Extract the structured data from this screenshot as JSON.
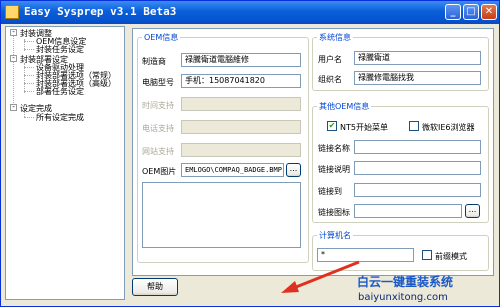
{
  "window": {
    "title": "Easy Sysprep v3.1 Beta3"
  },
  "tree": {
    "items": [
      {
        "label": "封装调整"
      },
      {
        "label": "OEM信息设定"
      },
      {
        "label": "封装任务设定"
      },
      {
        "label": "封装部署设定"
      },
      {
        "label": "设备驱动处理"
      },
      {
        "label": "封装部署选项（常规）"
      },
      {
        "label": "封装部署选项（高级）"
      },
      {
        "label": "部署任务设定"
      },
      {
        "label": "设定完成"
      },
      {
        "label": "所有设定完成"
      }
    ]
  },
  "oem": {
    "legend": "OEM信息",
    "manufacturer_label": "制造商",
    "manufacturer_value": "禄騰衛道電腦維修",
    "model_label": "电脑型号",
    "model_value": "手机：15087041820",
    "hours_label": "时间支持",
    "phone_label": "电话支持",
    "web_label": "网站支持",
    "image_label": "OEM图片",
    "image_value": "EMLOGO\\COMPAQ_BADGE.BMP",
    "browse_label": "..."
  },
  "system": {
    "legend": "系统信息",
    "user_label": "用户名",
    "user_value": "禄騰衛道",
    "org_label": "组织名",
    "org_value": "禄騰修電腦找我"
  },
  "other": {
    "legend": "其他OEM信息",
    "nt5_label": "NT5开始菜单",
    "nt5_checked": true,
    "ie6_label": "微软IE6浏览器",
    "ie6_checked": false,
    "link_name_label": "链接名称",
    "link_desc_label": "链接说明",
    "link_to_label": "链接到",
    "link_icon_label": "链接图标",
    "browse_label": "..."
  },
  "computer": {
    "legend": "计算机名",
    "value": "*",
    "prefix_label": "前缀模式",
    "prefix_checked": false
  },
  "footer": {
    "help_label": "帮助"
  },
  "watermark": {
    "line1": "白云一键重装系统",
    "line2": "baiyunxitong.com"
  }
}
